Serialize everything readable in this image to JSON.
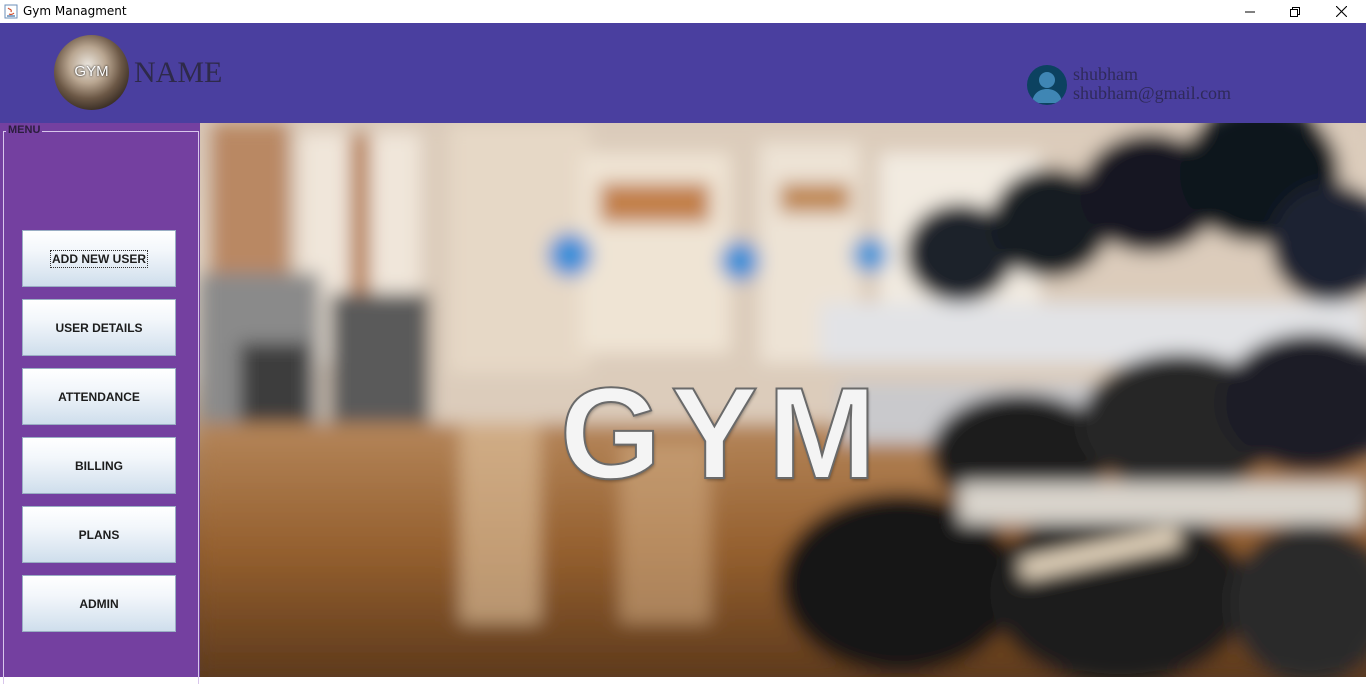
{
  "window": {
    "title": "Gym Managment",
    "controls": [
      "minimize-icon",
      "restore-icon",
      "close-icon"
    ]
  },
  "header": {
    "logo_text": "GYM",
    "brand_name": "NAME",
    "user": {
      "name": "shubham",
      "email": "shubham@gmail.com",
      "avatar_icon": "user-avatar-icon"
    }
  },
  "sidebar": {
    "menu_title": "MENU",
    "buttons": [
      {
        "label": "ADD NEW USER"
      },
      {
        "label": "USER DETAILS"
      },
      {
        "label": "ATTENDANCE"
      },
      {
        "label": "BILLING"
      },
      {
        "label": "PLANS"
      },
      {
        "label": "ADMIN"
      }
    ]
  },
  "hero": {
    "title": "GYM"
  },
  "colors": {
    "header_bg": "#4a3f9f",
    "sidebar_bg": "#7440a0",
    "avatar_bg": "#0c4260"
  }
}
